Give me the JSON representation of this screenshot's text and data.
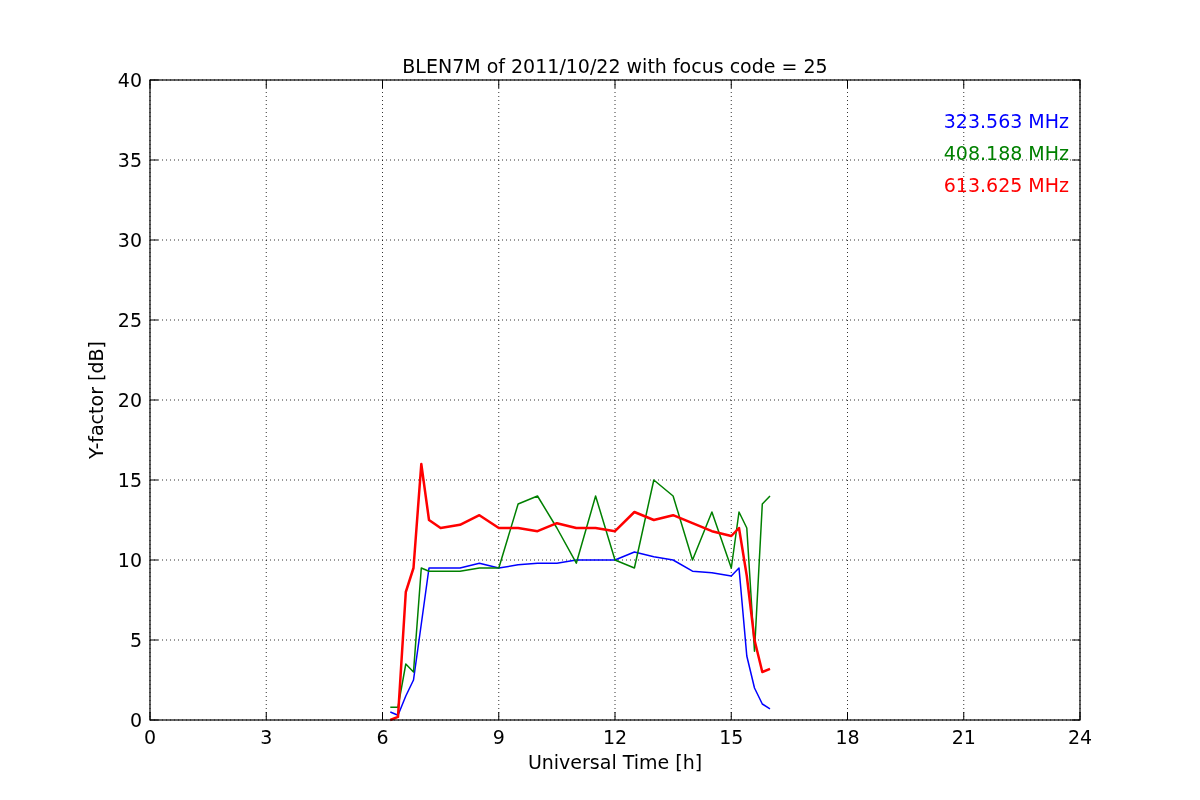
{
  "figure": {
    "chart_data": {
      "type": "line",
      "title": "BLEN7M of 2011/10/22 with focus code = 25",
      "xlabel": "Universal Time [h]",
      "ylabel": "Y-factor [dB]",
      "x": [
        6.2,
        6.4,
        6.6,
        6.8,
        7.0,
        7.2,
        7.5,
        8,
        8.5,
        9,
        9.5,
        10,
        10.5,
        11,
        11.5,
        12,
        12.5,
        13,
        13.5,
        14,
        14.5,
        15,
        15.2,
        15.4,
        15.6,
        15.8,
        16
      ],
      "series": [
        {
          "name": "323.563 MHz",
          "color": "#0000ff",
          "values": [
            0.5,
            0.3,
            1.5,
            2.5,
            6,
            9.5,
            9.5,
            9.5,
            9.8,
            9.5,
            9.7,
            9.8,
            9.8,
            10,
            10,
            10,
            10.5,
            10.2,
            10,
            9.3,
            9.2,
            9,
            9.5,
            4,
            2,
            1,
            0.7
          ]
        },
        {
          "name": "408.188 MHz",
          "color": "#008000",
          "values": [
            0.8,
            0.8,
            3.5,
            3,
            9.5,
            9.3,
            9.3,
            9.3,
            9.5,
            9.5,
            13.5,
            14,
            12,
            9.8,
            14,
            10,
            9.5,
            15,
            14,
            10,
            13,
            9.5,
            13,
            12,
            4.3,
            13.5,
            14
          ]
        },
        {
          "name": "613.625 MHz",
          "color": "#ff0000",
          "values": [
            0,
            0.2,
            8,
            9.5,
            16,
            12.5,
            12,
            12.2,
            12.8,
            12,
            12,
            11.8,
            12.3,
            12,
            12,
            11.8,
            13,
            12.5,
            12.8,
            12.3,
            11.8,
            11.5,
            12,
            9,
            5,
            3,
            3.2
          ]
        }
      ],
      "xlim": [
        0,
        24
      ],
      "ylim": [
        0,
        40
      ],
      "xticks": [
        0,
        3,
        6,
        9,
        12,
        15,
        18,
        21,
        24
      ],
      "yticks": [
        0,
        5,
        10,
        15,
        20,
        25,
        30,
        35,
        40
      ],
      "grid": true
    }
  }
}
